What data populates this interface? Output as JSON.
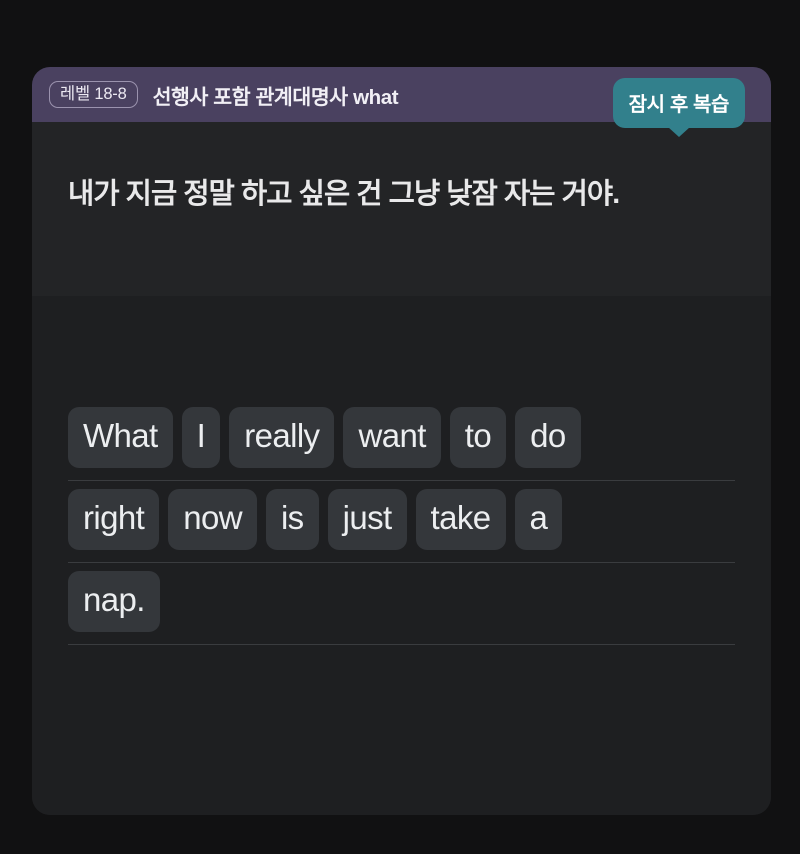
{
  "page": {
    "background_color": "#111112"
  },
  "card": {
    "background_color": "#1e1f21",
    "header": {
      "background_color": "#4a4160",
      "level_badge": "레벨 18-8",
      "title": "선행사 포함 관계대명사 what",
      "review_bubble": {
        "label": "잠시 후 복습",
        "color": "#32808c"
      }
    },
    "prompt": {
      "background_color": "#232426",
      "text": "내가 지금 정말 하고 싶은 건 그냥 낮잠 자는 거야."
    },
    "answer": {
      "tile_color": "#34373b",
      "divider_color": "#3a3c3f",
      "rows": [
        {
          "words": [
            "What",
            "I",
            "really",
            "want",
            "to",
            "do"
          ]
        },
        {
          "words": [
            "right",
            "now",
            "is",
            "just",
            "take",
            "a"
          ]
        },
        {
          "words": [
            "nap."
          ]
        }
      ],
      "full_sentence": "What I really want to do right now is just take a nap."
    }
  }
}
